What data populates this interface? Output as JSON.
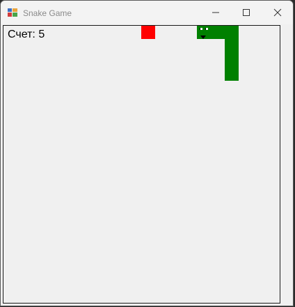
{
  "window": {
    "title": "Snake Game"
  },
  "score": {
    "label": "Счет:",
    "value": "5"
  },
  "colors": {
    "snake": "#008000",
    "food": "#ff0000",
    "board_background": "#f0f0f0"
  },
  "icons": {
    "app": "app-window-icon",
    "minimize": "minimize-icon",
    "maximize": "maximize-icon",
    "close": "close-icon"
  }
}
